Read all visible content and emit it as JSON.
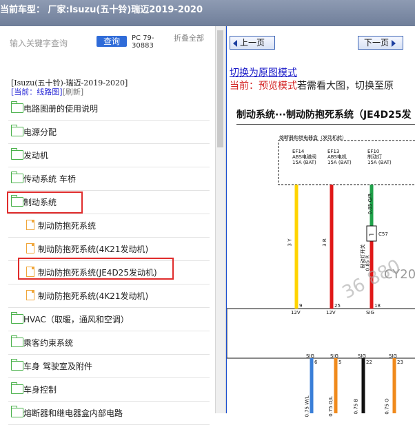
{
  "title": "当前车型：  厂家:Isuzu(五十铃)瑞迈2019-2020",
  "search": {
    "placeholder": "输入关键字查询",
    "button": "查询",
    "pc": "PC 79-30883",
    "collapse": "折叠全部"
  },
  "breadcrumb": "[Isuzu(五十铃)-瑞迈-2019-2020]",
  "current": {
    "prefix": "[当前：",
    "value": "线路图]",
    "refresh": "[刷新]"
  },
  "tree": [
    {
      "label": "电路图册的使用说明",
      "type": "folder",
      "indent": 0
    },
    {
      "label": "电源分配",
      "type": "folder",
      "indent": 0
    },
    {
      "label": "发动机",
      "type": "folder",
      "indent": 0
    },
    {
      "label": "传动系统 车桥",
      "type": "folder",
      "indent": 0
    },
    {
      "label": "制动系统",
      "type": "folder",
      "indent": 0,
      "highlighted": true
    },
    {
      "label": "制动防抱死系统",
      "type": "file",
      "indent": 1
    },
    {
      "label": "制动防抱死系统(4K21发动机)",
      "type": "file",
      "indent": 1
    },
    {
      "label": "制动防抱死系统(JE4D25发动机)",
      "type": "file",
      "indent": 1,
      "highlighted": true
    },
    {
      "label": "制动防抱死系统(4K21发动机)",
      "type": "file",
      "indent": 1
    },
    {
      "label": "HVAC（取暖，通风和空调）",
      "type": "folder",
      "indent": 0
    },
    {
      "label": "乘客约束系统",
      "type": "folder",
      "indent": 0
    },
    {
      "label": "车身 驾驶室及附件",
      "type": "folder",
      "indent": 0
    },
    {
      "label": "车身控制",
      "type": "folder",
      "indent": 0
    },
    {
      "label": "熔断器和继电器盒内部电路",
      "type": "folder",
      "indent": 0
    }
  ],
  "viewer": {
    "prev": "上一页",
    "next": "下一页",
    "link": "切换为原图模式",
    "preview_prefix": "当前：",
    "preview_mode": "预览模式",
    "preview_tail": "若需看大图，切换至原",
    "diagram_title": "制动系统···制动防抱死系统（JE4D25发",
    "box_label": "熔断器和继电器盒（发动机舱）",
    "fuses": [
      {
        "id": "EF14",
        "name": "ABS电磁阀",
        "rating": "15A (BAT)"
      },
      {
        "id": "EF13",
        "name": "ABS电机",
        "rating": "15A (BAT)"
      },
      {
        "id": "EF10",
        "name": "制动灯",
        "rating": "15A (BAT)"
      }
    ],
    "wires": [
      "3 Y",
      "3 R",
      "0.85 G/R",
      "0.85 R"
    ],
    "connector": "C57",
    "switch_label": "制动灯开关",
    "pins_top": [
      "9",
      "25",
      "18"
    ],
    "pins_top_labels": [
      "12V",
      "12V",
      "SIG"
    ],
    "pins_bottom": [
      "6",
      "5",
      "22",
      "23"
    ],
    "pins_bottom_labels": [
      "SIG",
      "SIG",
      "SIG",
      "SIG"
    ],
    "wires_bottom": [
      "0.75 W/L",
      "0.75 O/L",
      "0.75 B",
      "0.75 O"
    ],
    "watermark": "CY20",
    "colors": {
      "yellow": "#ffd400",
      "red": "#e01818",
      "green": "#1fa24a",
      "orange": "#f08a1c",
      "blue": "#2f6bd8"
    }
  }
}
